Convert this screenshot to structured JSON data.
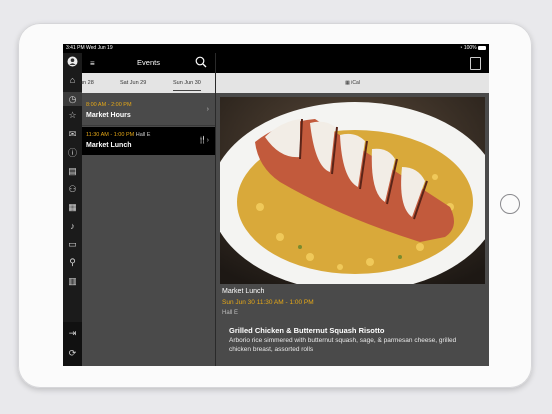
{
  "status": {
    "time_date": "3:41 PM  Wed Jun 19",
    "battery": "100%"
  },
  "events_header": {
    "title": "Events"
  },
  "days": [
    "un 28",
    "Sat  Jun 29",
    "Sun  Jun 30"
  ],
  "events": [
    {
      "time": "8:00 AM - 2:00 PM",
      "location": "",
      "name": "Market Hours"
    },
    {
      "time": "11:30 AM - 1:00 PM",
      "location": "Hall E",
      "name": "Market Lunch"
    }
  ],
  "detail": {
    "ical_label": "iCal",
    "title": "Market Lunch",
    "datetime": "Sun  Jun 30 11:30 AM - 1:00 PM",
    "location": "Hall E",
    "dish": "Grilled Chicken & Butternut Squash Risotto",
    "description": "Arborio rice simmered with butternut squash, sage, & parmesan cheese, grilled chicken breast, assorted rolls"
  },
  "colors": {
    "accent": "#e6a817",
    "chrome": "#000000",
    "panel": "#4a4a4a"
  },
  "rail_icons": [
    "avatar-icon",
    "home-icon",
    "clock-icon",
    "star-icon",
    "mail-icon",
    "info-icon",
    "newspaper-icon",
    "people-icon",
    "store-icon",
    "microphone-icon",
    "folder-icon",
    "map-pin-icon",
    "map-icon",
    "logout-icon",
    "refresh-icon"
  ]
}
